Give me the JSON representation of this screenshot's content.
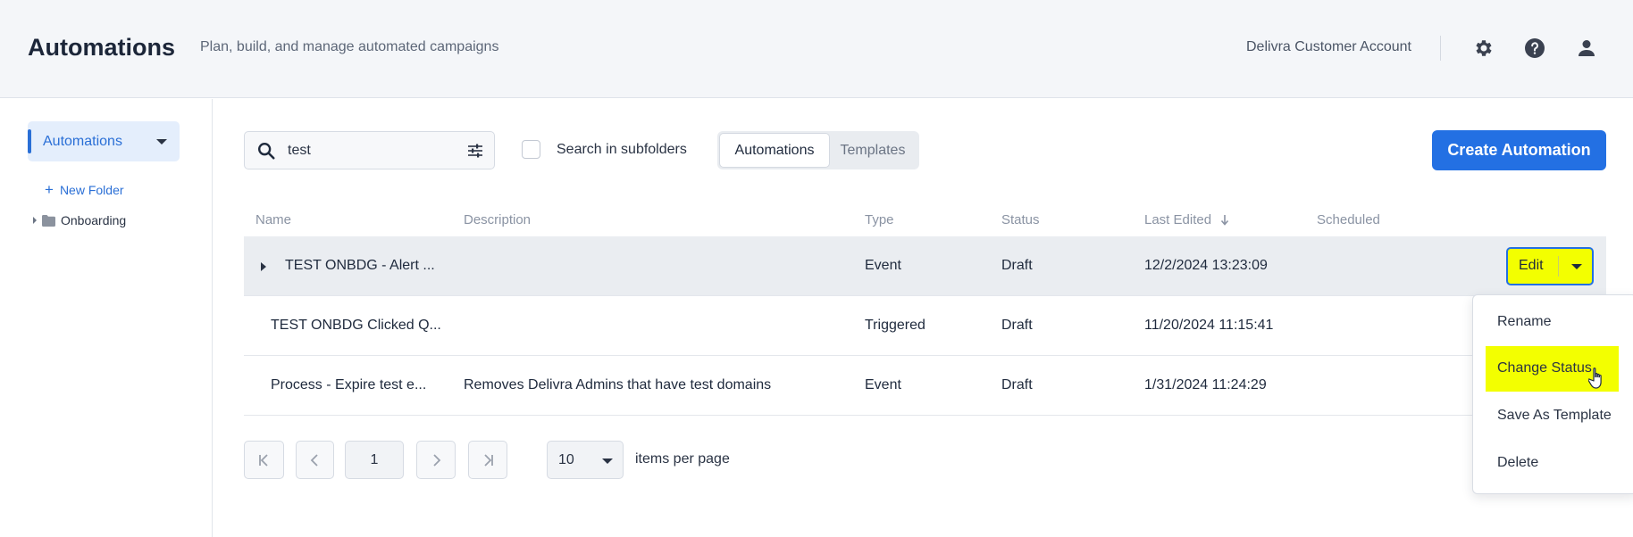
{
  "header": {
    "title": "Automations",
    "subtitle": "Plan, build, and manage automated campaigns",
    "account": "Delivra Customer Account",
    "icons": [
      "gear-icon",
      "help-icon",
      "user-icon"
    ]
  },
  "sidebar": {
    "active_label": "Automations",
    "new_folder": "New Folder",
    "folders": [
      {
        "label": "Onboarding"
      }
    ]
  },
  "toolbar": {
    "search_value": "test",
    "subfolders_label": "Search in subfolders",
    "subfolders_checked": false,
    "tabs": [
      {
        "label": "Automations",
        "active": true
      },
      {
        "label": "Templates",
        "active": false
      }
    ],
    "create_label": "Create Automation"
  },
  "table": {
    "columns": [
      "Name",
      "Description",
      "Type",
      "Status",
      "Last Edited",
      "Scheduled"
    ],
    "sorted_column": "Last Edited",
    "rows": [
      {
        "name": "TEST ONBDG - Alert ...",
        "description": "",
        "type": "Event",
        "status": "Draft",
        "last_edited": "12/2/2024 13:23:09",
        "scheduled": ""
      },
      {
        "name": "TEST ONBDG Clicked Q...",
        "description": "",
        "type": "Triggered",
        "status": "Draft",
        "last_edited": "11/20/2024 11:15:41",
        "scheduled": ""
      },
      {
        "name": "Process - Expire test e...",
        "description": "Removes Delivra Admins that have test domains",
        "type": "Event",
        "status": "Draft",
        "last_edited": "1/31/2024 11:24:29",
        "scheduled": ""
      }
    ],
    "edit_label": "Edit"
  },
  "menu": {
    "items": [
      "Rename",
      "Change Status",
      "Save As Template",
      "Delete"
    ],
    "highlighted": "Change Status"
  },
  "pagination": {
    "current_page": "1",
    "per_page": "10",
    "per_page_label": "items per page"
  },
  "colors": {
    "accent": "#2370e3",
    "highlight": "#f3ff00"
  }
}
